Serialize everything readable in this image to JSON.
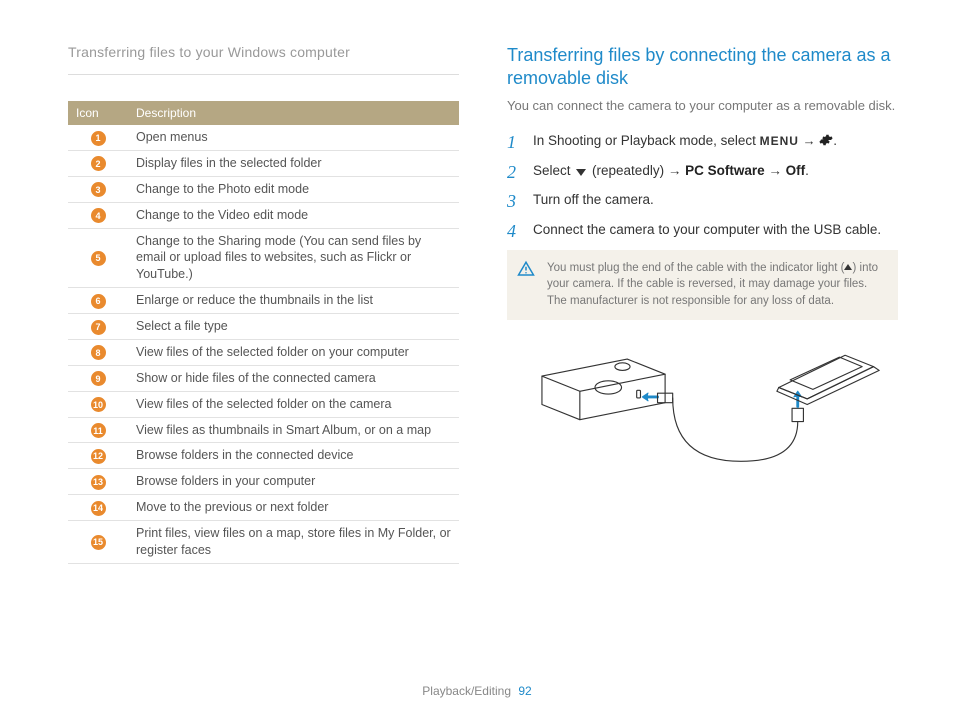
{
  "header": "Transferring files to your Windows computer",
  "table": {
    "headers": [
      "Icon",
      "Description"
    ],
    "rows": [
      "Open menus",
      "Display files in the selected folder",
      "Change to the Photo edit mode",
      "Change to the Video edit mode",
      "Change to the Sharing mode (You can send files by email or upload files to websites, such as Flickr or YouTube.)",
      "Enlarge or reduce the thumbnails in the list",
      "Select a file type",
      "View files of the selected folder on your computer",
      "Show or hide files of the connected camera",
      "View files of the selected folder on the camera",
      "View files as thumbnails in Smart Album, or on a map",
      "Browse folders in the connected device",
      "Browse folders in your computer",
      "Move to the previous or next folder",
      "Print files, view files on a map, store files in My Folder, or register faces"
    ]
  },
  "section_title": "Transferring files by connecting the camera as a removable disk",
  "intro": "You can connect the camera to your computer as a removable disk.",
  "steps": {
    "s1_a": "In Shooting or Playback mode, select ",
    "s1_menu": "MENU",
    "s1_arrow": " → ",
    "s2_a": "Select ",
    "s2_b": " (repeatedly) → ",
    "s2_pc": "PC Software",
    "s2_c": " → ",
    "s2_off": "Off",
    "s2_d": ".",
    "s3": "Turn off the camera.",
    "s4": "Connect the camera to your computer with the USB cable."
  },
  "warn": {
    "a": "You must plug the end of the cable with the indicator light (",
    "b": ") into your camera. If the cable is reversed, it may damage your files. The manufacturer is not responsible for any loss of data."
  },
  "footer_section": "Playback/Editing",
  "footer_page": "92"
}
